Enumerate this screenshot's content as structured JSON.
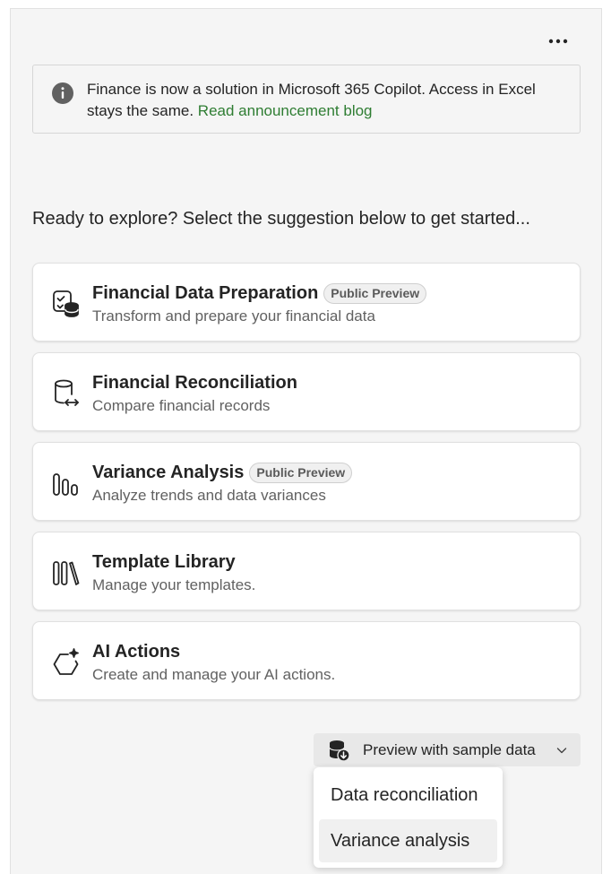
{
  "header": {
    "more_options_icon": "more-horizontal-icon"
  },
  "notice": {
    "icon": "info-icon",
    "text": "Finance is now a solution in Microsoft 365 Copilot. Access in Excel stays the same.",
    "link_label": "Read announcement blog"
  },
  "prompt": "Ready to explore? Select the suggestion below to get started...",
  "cards": [
    {
      "icon": "data-preparation-icon",
      "title": "Financial Data Preparation",
      "badge": "Public Preview",
      "description": "Transform and prepare your financial data"
    },
    {
      "icon": "reconciliation-icon",
      "title": "Financial Reconciliation",
      "badge": "",
      "description": "Compare financial records"
    },
    {
      "icon": "variance-analysis-icon",
      "title": "Variance Analysis",
      "badge": "Public Preview",
      "description": "Analyze trends and data variances"
    },
    {
      "icon": "template-library-icon",
      "title": "Template Library",
      "badge": "",
      "description": "Manage your templates."
    },
    {
      "icon": "ai-actions-icon",
      "title": "AI Actions",
      "badge": "",
      "description": "Create and manage your AI actions."
    }
  ],
  "sample_button": {
    "icon": "database-download-icon",
    "label": "Preview with sample data"
  },
  "sample_menu": {
    "items": [
      "Data reconciliation",
      "Variance analysis"
    ]
  }
}
